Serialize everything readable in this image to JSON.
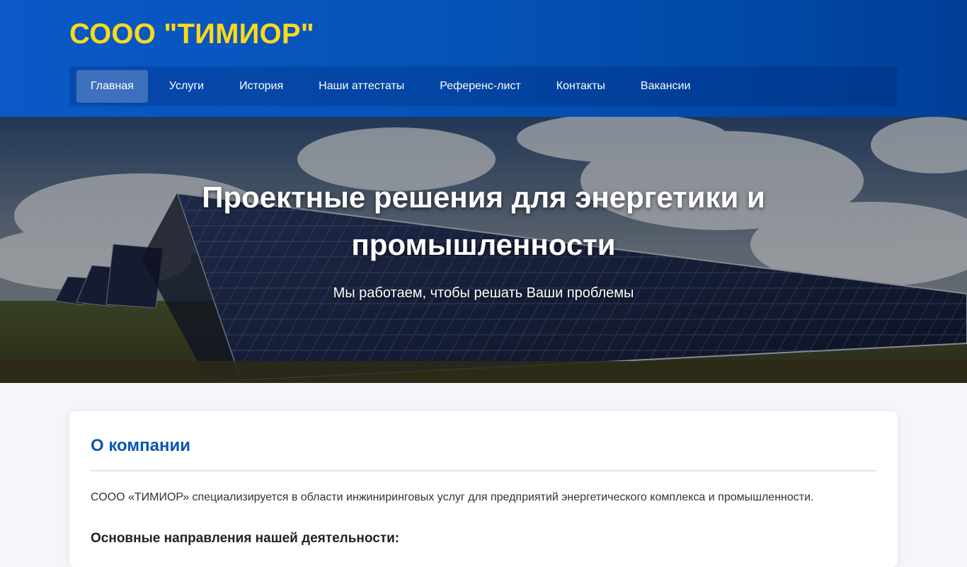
{
  "header": {
    "brand": "СООО \"ТИМИОР\"",
    "colors": {
      "brand_text": "#ffd91a",
      "header_bg": "#0553b8"
    }
  },
  "nav": {
    "items": [
      {
        "label": "Главная",
        "active": true
      },
      {
        "label": "Услуги",
        "active": false
      },
      {
        "label": "История",
        "active": false
      },
      {
        "label": "Наши аттестаты",
        "active": false
      },
      {
        "label": "Референс-лист",
        "active": false
      },
      {
        "label": "Контакты",
        "active": false
      },
      {
        "label": "Вакансии",
        "active": false
      }
    ]
  },
  "hero": {
    "title_line1": "Проектные решения для энергетики и",
    "title_line2": "промышленности",
    "subtitle": "Мы работаем, чтобы решать Ваши проблемы",
    "background_image": "solar-panels-field-photo"
  },
  "about": {
    "title": "О компании",
    "text": "СООО «ТИМИОР» специализируется в области инжиниринговых услуг для предприятий энергетического комплекса и промышленности.",
    "subheading": "Основные направления нашей деятельности:",
    "accent_color": "#0b56b0"
  }
}
